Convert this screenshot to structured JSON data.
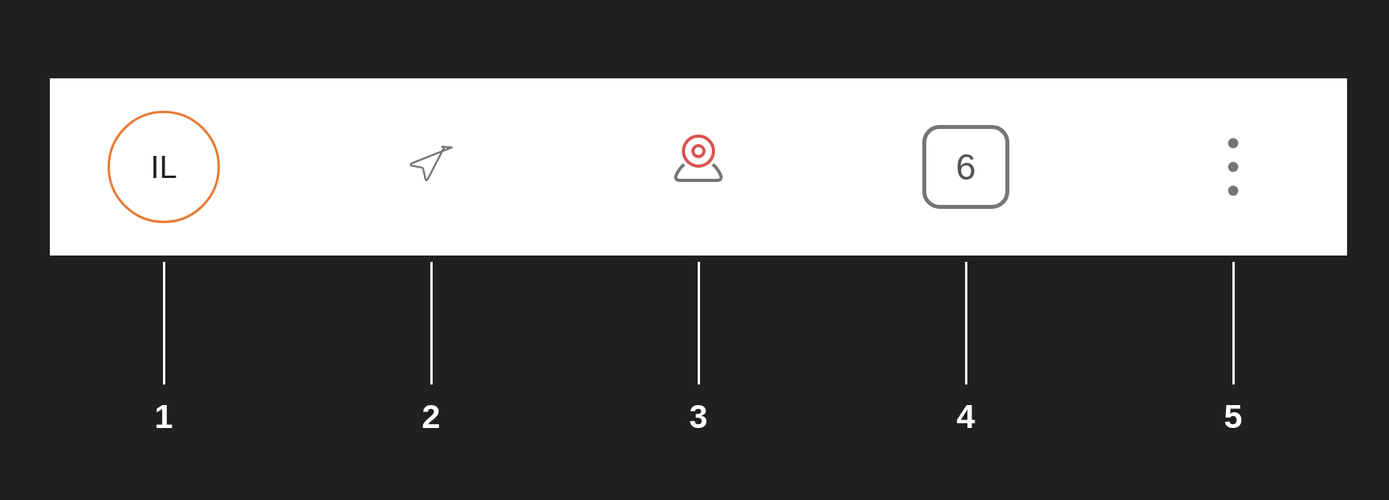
{
  "toolbar": {
    "items": [
      {
        "kind": "avatar",
        "initials": "IL"
      },
      {
        "kind": "send"
      },
      {
        "kind": "camera"
      },
      {
        "kind": "badge",
        "count": "6"
      },
      {
        "kind": "more"
      }
    ]
  },
  "callouts": [
    "1",
    "2",
    "3",
    "4",
    "5"
  ]
}
